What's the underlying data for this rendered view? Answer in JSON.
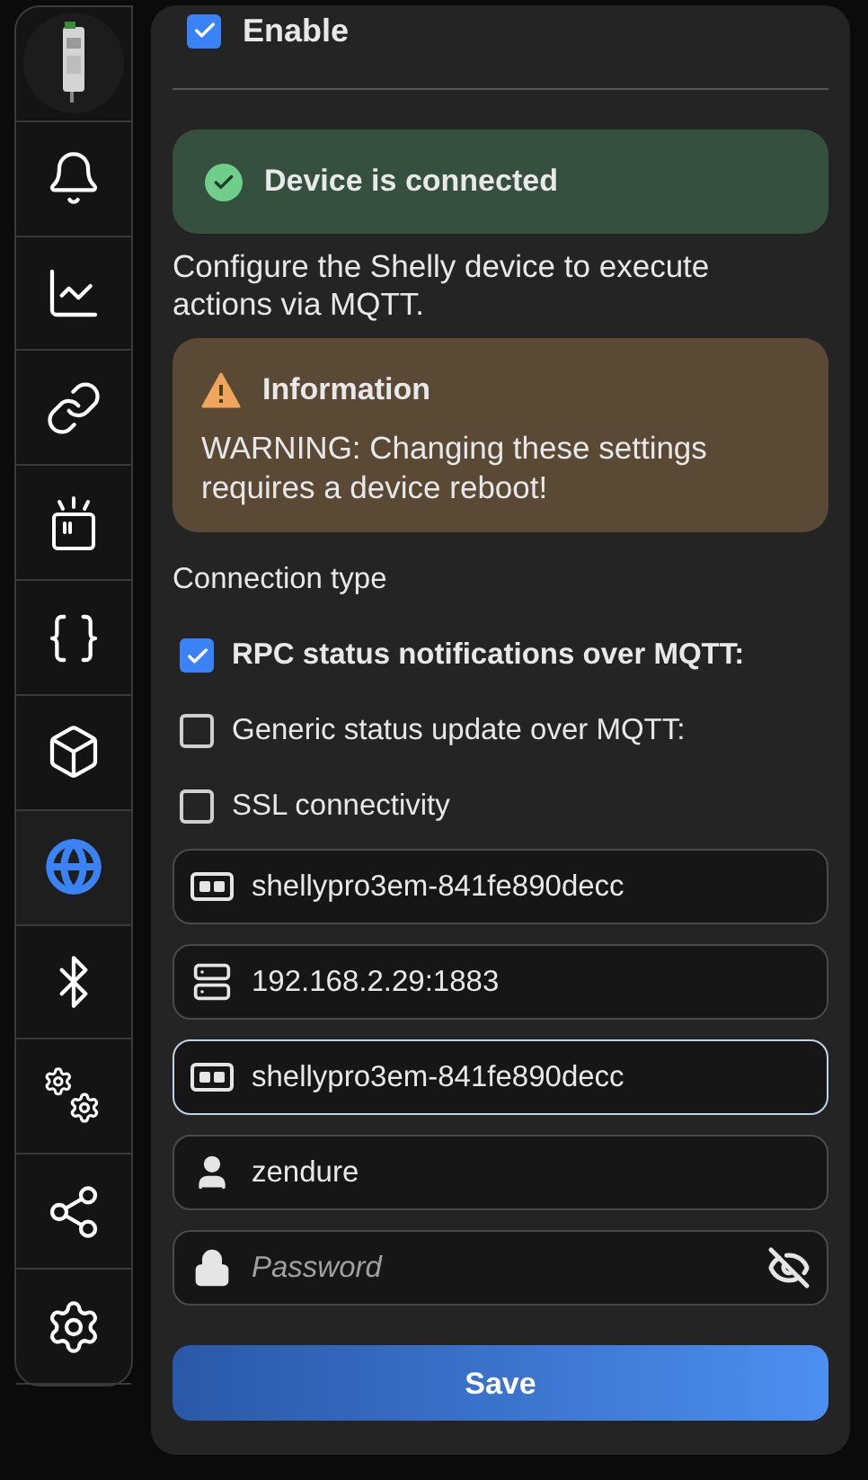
{
  "sidebar": {
    "items": [
      {
        "selected": false
      },
      {
        "selected": false
      },
      {
        "selected": false
      },
      {
        "selected": false
      },
      {
        "selected": false
      },
      {
        "selected": false
      },
      {
        "selected": false
      },
      {
        "selected": true
      },
      {
        "selected": false
      },
      {
        "selected": false
      },
      {
        "selected": false
      },
      {
        "selected": false
      }
    ]
  },
  "enable": {
    "label": "Enable",
    "checked": true
  },
  "status": {
    "text": "Device is connected"
  },
  "description": "Configure the Shelly device to execute actions via MQTT.",
  "info": {
    "title": "Information",
    "text": "WARNING: Changing these settings requires a device reboot!"
  },
  "connection_type": {
    "label": "Connection type"
  },
  "options": [
    {
      "label": "RPC status notifications over MQTT:",
      "checked": true
    },
    {
      "label": "Generic status update over MQTT:",
      "checked": false
    },
    {
      "label": "SSL connectivity",
      "checked": false
    }
  ],
  "fields": [
    {
      "kind": "text",
      "value": "shellypro3em-841fe890decc",
      "focused": false
    },
    {
      "kind": "server",
      "value": "192.168.2.29:1883",
      "focused": false
    },
    {
      "kind": "text",
      "value": "shellypro3em-841fe890decc",
      "focused": true
    },
    {
      "kind": "user",
      "value": "zendure",
      "focused": false
    },
    {
      "kind": "password",
      "placeholder": "Password",
      "focused": false
    }
  ],
  "save_button": {
    "label": "Save"
  }
}
